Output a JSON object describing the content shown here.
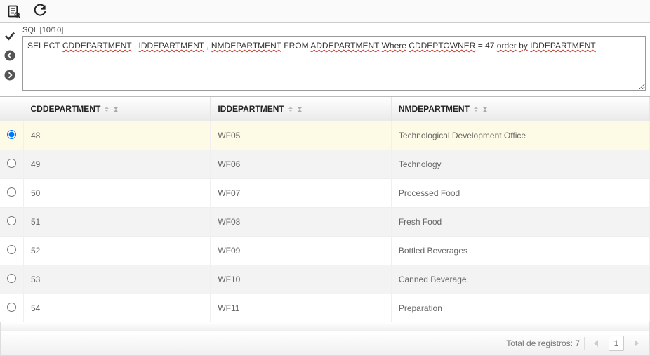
{
  "toolbar": {
    "results_icon": "results-icon",
    "refresh_icon": "refresh-icon"
  },
  "sql": {
    "label": "SQL [10/10]",
    "tokens": [
      {
        "t": "SELECT ",
        "u": false
      },
      {
        "t": "CDDEPARTMENT",
        "u": true
      },
      {
        "t": " , ",
        "u": false
      },
      {
        "t": "IDDEPARTMENT",
        "u": true
      },
      {
        "t": " , ",
        "u": false
      },
      {
        "t": "NMDEPARTMENT",
        "u": true
      },
      {
        "t": " FROM ",
        "u": false
      },
      {
        "t": "ADDEPARTMENT",
        "u": true
      },
      {
        "t": " ",
        "u": false
      },
      {
        "t": "Where",
        "u": true
      },
      {
        "t": " ",
        "u": false
      },
      {
        "t": "CDDEPTOWNER",
        "u": true
      },
      {
        "t": " = 47 ",
        "u": false
      },
      {
        "t": "order",
        "u": true
      },
      {
        "t": " ",
        "u": false
      },
      {
        "t": "by",
        "u": true
      },
      {
        "t": " ",
        "u": false
      },
      {
        "t": "IDDEPARTMENT",
        "u": true
      }
    ]
  },
  "columns": [
    "CDDEPARTMENT",
    "IDDEPARTMENT",
    "NMDEPARTMENT"
  ],
  "rows": [
    {
      "selected": true,
      "cd": "48",
      "id": "WF05",
      "nm": "Technological Development Office"
    },
    {
      "selected": false,
      "cd": "49",
      "id": "WF06",
      "nm": "Technology"
    },
    {
      "selected": false,
      "cd": "50",
      "id": "WF07",
      "nm": "Processed Food"
    },
    {
      "selected": false,
      "cd": "51",
      "id": "WF08",
      "nm": "Fresh Food"
    },
    {
      "selected": false,
      "cd": "52",
      "id": "WF09",
      "nm": "Bottled Beverages"
    },
    {
      "selected": false,
      "cd": "53",
      "id": "WF10",
      "nm": "Canned Beverage"
    },
    {
      "selected": false,
      "cd": "54",
      "id": "WF11",
      "nm": "Preparation"
    }
  ],
  "footer": {
    "total_label": "Total de registros: 7",
    "page": "1"
  }
}
